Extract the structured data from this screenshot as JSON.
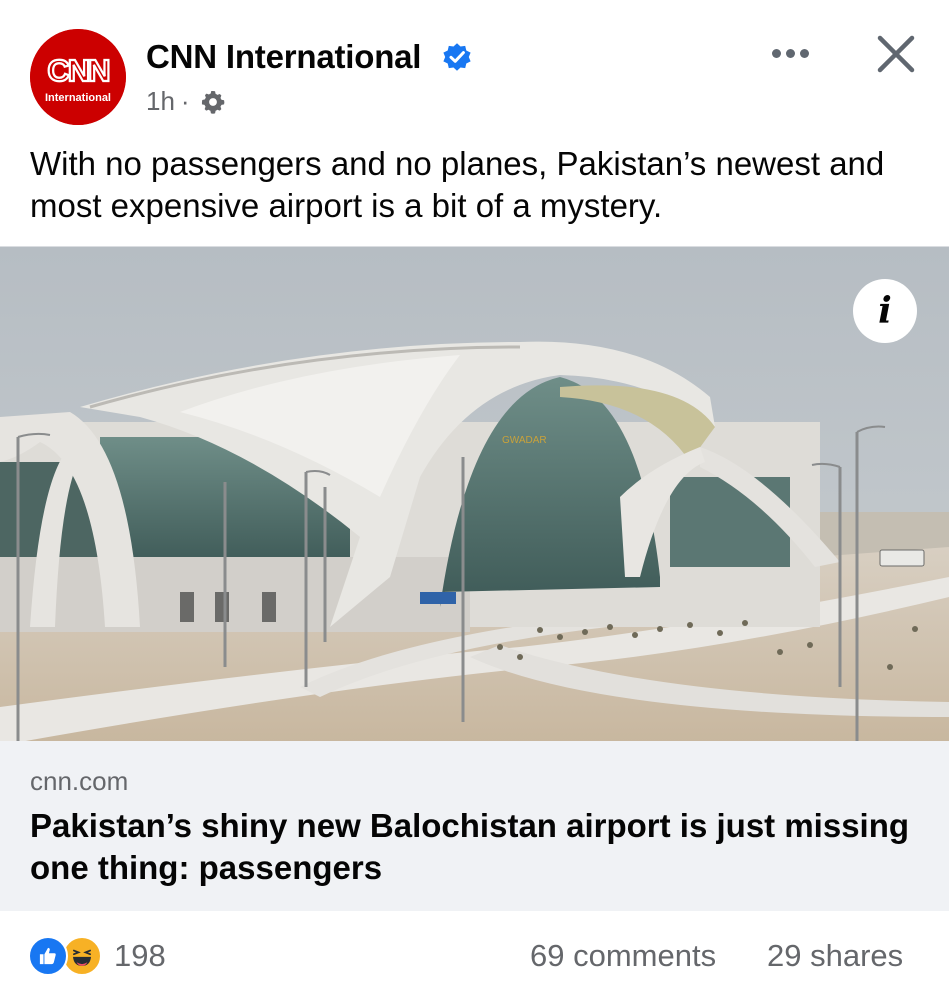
{
  "post": {
    "page_name": "CNN International",
    "time": "1h",
    "separator": "·",
    "avatar_logo": "CNN",
    "avatar_sub": "International",
    "caption": "With no passengers and no planes, Pakistan’s newest and most expensive airport is a bit of a mystery."
  },
  "photo": {
    "info_label": "i",
    "sign_text": "GWADAR"
  },
  "link": {
    "domain": "cnn.com",
    "title": "Pakistan’s shiny new Balochistan airport is just missing one thing: passengers"
  },
  "footer": {
    "reaction_count": "198",
    "comments": "69 comments",
    "shares": "29 shares"
  },
  "icons": {
    "verified": "verified-badge-icon",
    "privacy": "gear-icon",
    "more": "more-options-icon",
    "close": "close-icon",
    "like": "like-reaction-icon",
    "haha": "haha-reaction-icon"
  },
  "colors": {
    "cnn_red": "#cc0000",
    "verified_blue": "#1877f2",
    "meta_gray": "#65676b",
    "link_bg": "#f0f2f5"
  }
}
